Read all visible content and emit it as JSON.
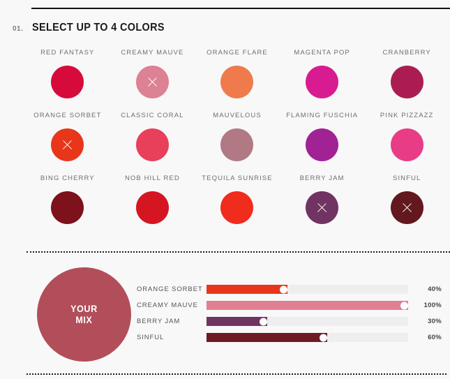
{
  "step": {
    "number": "01.",
    "title": "SELECT UP TO 4 COLORS"
  },
  "palette": [
    {
      "label": "RED FANTASY",
      "color": "#d70a3c",
      "selected": false
    },
    {
      "label": "CREAMY MAUVE",
      "color": "#dd8194",
      "selected": true
    },
    {
      "label": "ORANGE FLARE",
      "color": "#ef7b4d",
      "selected": false
    },
    {
      "label": "MAGENTA POP",
      "color": "#d91b92",
      "selected": false
    },
    {
      "label": "CRANBERRY",
      "color": "#ab1d52",
      "selected": false
    },
    {
      "label": "ORANGE SORBET",
      "color": "#e8361b",
      "selected": true
    },
    {
      "label": "CLASSIC CORAL",
      "color": "#e83f5b",
      "selected": false
    },
    {
      "label": "MAUVELOUS",
      "color": "#b07984",
      "selected": false
    },
    {
      "label": "FLAMING FUSCHIA",
      "color": "#a02294",
      "selected": false
    },
    {
      "label": "PINK PIZZAZZ",
      "color": "#e83d86",
      "selected": false
    },
    {
      "label": "BING CHERRY",
      "color": "#7d111c",
      "selected": false
    },
    {
      "label": "NOB HILL RED",
      "color": "#d51622",
      "selected": false
    },
    {
      "label": "TEQUILA SUNRISE",
      "color": "#f02c1d",
      "selected": false
    },
    {
      "label": "BERRY JAM",
      "color": "#713361",
      "selected": true
    },
    {
      "label": "SINFUL",
      "color": "#63171f",
      "selected": true
    }
  ],
  "mix": {
    "circle_label_line1": "YOUR",
    "circle_label_line2": "MIX",
    "circle_color": "#b24e5a",
    "track_color": "#eeeeee",
    "sliders": [
      {
        "name": "ORANGE SORBET",
        "percent": 40,
        "percent_label": "40%",
        "color": "#e8361b"
      },
      {
        "name": "CREAMY MAUVE",
        "percent": 100,
        "percent_label": "100%",
        "color": "#e07f92"
      },
      {
        "name": "BERRY JAM",
        "percent": 30,
        "percent_label": "30%",
        "color": "#713361"
      },
      {
        "name": "SINFUL",
        "percent": 60,
        "percent_label": "60%",
        "color": "#6d1b23"
      }
    ]
  }
}
